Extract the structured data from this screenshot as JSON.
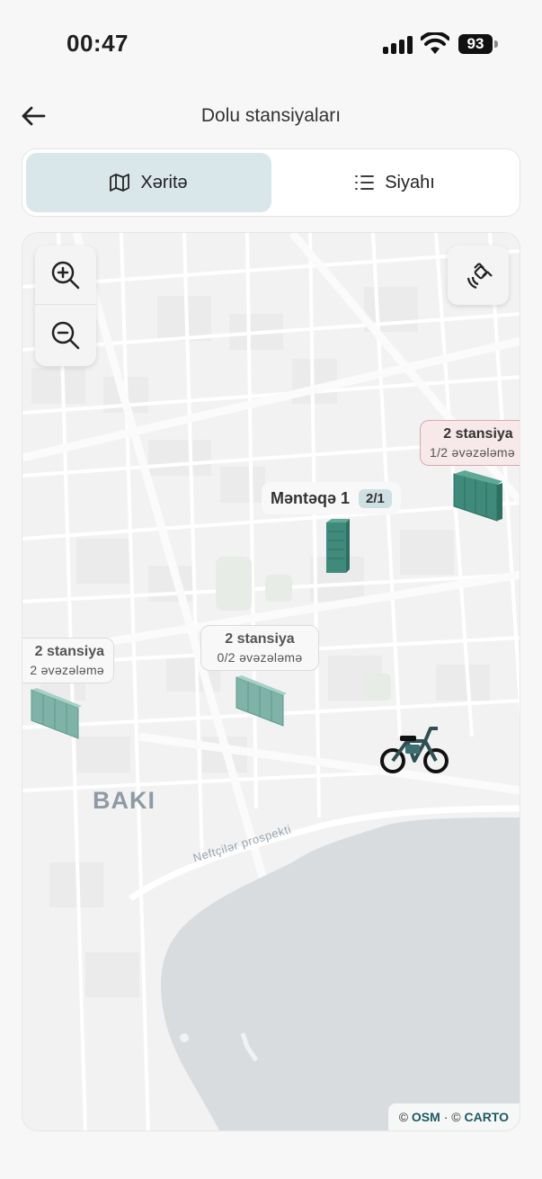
{
  "status_bar": {
    "time": "00:47",
    "battery": "93"
  },
  "header": {
    "title": "Dolu stansiyaları"
  },
  "tabs": [
    {
      "label": "Xəritə",
      "icon": "map-icon",
      "active": true
    },
    {
      "label": "Siyahı",
      "icon": "list-icon",
      "active": false
    }
  ],
  "map": {
    "city_label": "BAKI",
    "street_label": "Neftçilər prospekti",
    "attribution": {
      "prefix1": "© ",
      "osm": "OSM",
      "sep": " · © ",
      "carto": "CARTO"
    },
    "controls": {
      "zoom_in": "zoom-in-icon",
      "zoom_out": "zoom-out-icon",
      "locate": "satellite-icon"
    },
    "station_pill": {
      "name": "Məntəqə 1",
      "count": "2/1"
    },
    "labels": [
      {
        "line1": "2 stansiya",
        "line2": "1/2 əvəzələmə",
        "highlight": true
      },
      {
        "line1": "2 stansiya",
        "line2": "0/2 əvəzələmə",
        "highlight": false
      },
      {
        "line1": "2 stansiya",
        "line2": "2 əvəzələmə",
        "highlight": false
      }
    ],
    "colors": {
      "station": "#3f8a7b",
      "water": "#d8dcdf",
      "highlight_border": "#d9a8ad",
      "active_tab": "#d9e7ea"
    }
  }
}
